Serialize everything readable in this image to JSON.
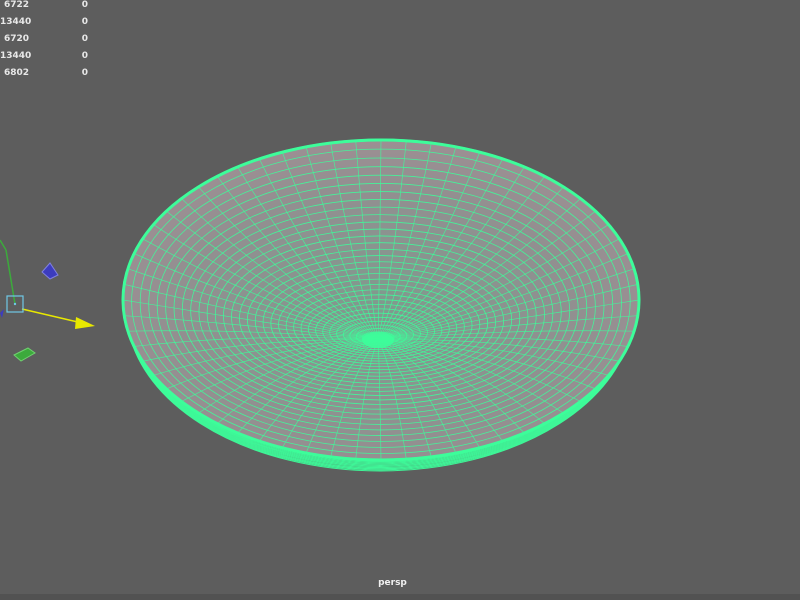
{
  "hud": {
    "rows": [
      {
        "value": "6722",
        "selected": "0"
      },
      {
        "value": "13440",
        "selected": "0"
      },
      {
        "value": "6720",
        "selected": "0"
      },
      {
        "value": "13440",
        "selected": "0"
      },
      {
        "value": "6802",
        "selected": "0"
      }
    ]
  },
  "viewport": {
    "camera": "persp",
    "background_color": "#5d5d5d",
    "wire_color": "#3dfd9a",
    "bowl_fill_color": "#8f8f8f"
  },
  "manipulator": {
    "x_axis_color": "#e8e800",
    "y_axis_color": "#3caa3c",
    "z_axis_color": "#3c3cbe",
    "handle_color": "#6fc8e6"
  }
}
